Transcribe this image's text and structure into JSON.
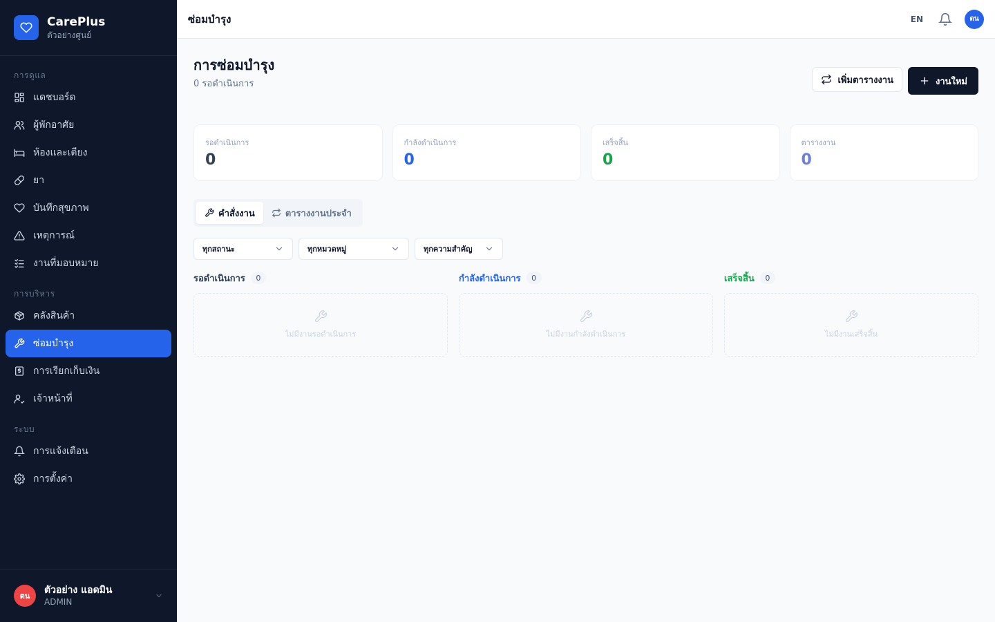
{
  "colors": {
    "sidebar_bg": "#0f172a",
    "accent": "#2563eb",
    "pending": "#334155",
    "in_progress": "#2563eb",
    "completed": "#16a34a",
    "schedules": "#6b7fd7",
    "user_avatar": "#ef4444"
  },
  "brand": {
    "name": "CarePlus",
    "subtitle": "ตัวอย่างศูนย์",
    "icon": "heart-icon"
  },
  "sidebar": {
    "sections": [
      {
        "label": "การดูแล",
        "items": [
          {
            "label": "แดชบอร์ด",
            "icon": "dashboard-icon"
          },
          {
            "label": "ผู้พักอาศัย",
            "icon": "users-icon"
          },
          {
            "label": "ห้องและเตียง",
            "icon": "bed-icon"
          },
          {
            "label": "ยา",
            "icon": "pill-icon"
          },
          {
            "label": "บันทึกสุขภาพ",
            "icon": "heart-icon"
          },
          {
            "label": "เหตุการณ์",
            "icon": "warning-icon"
          },
          {
            "label": "งานที่มอบหมาย",
            "icon": "task-list-icon"
          }
        ]
      },
      {
        "label": "การบริหาร",
        "items": [
          {
            "label": "คลังสินค้า",
            "icon": "package-icon"
          },
          {
            "label": "ซ่อมบำรุง",
            "icon": "wrench-icon",
            "active": true
          },
          {
            "label": "การเรียกเก็บเงิน",
            "icon": "receipt-icon"
          },
          {
            "label": "เจ้าหน้าที่",
            "icon": "user-check-icon"
          }
        ]
      },
      {
        "label": "ระบบ",
        "items": [
          {
            "label": "การแจ้งเตือน",
            "icon": "bell-icon"
          },
          {
            "label": "การตั้งค่า",
            "icon": "gear-icon"
          }
        ]
      }
    ]
  },
  "user": {
    "initials": "ตน",
    "name": "ตัวอย่าง แอดมิน",
    "role": "ADMIN"
  },
  "header": {
    "title": "ซ่อมบำรุง",
    "lang": "EN",
    "avatar_initials": "ตน"
  },
  "page": {
    "title": "การซ่อมบำรุง",
    "subtitle": "0 รอดำเนินการ",
    "add_schedule_label": "เพิ่มตารางงาน",
    "new_job_label": "งานใหม่"
  },
  "stats": [
    {
      "label": "รอดำเนินการ",
      "value": "0"
    },
    {
      "label": "กำลังดำเนินการ",
      "value": "0"
    },
    {
      "label": "เสร็จสิ้น",
      "value": "0"
    },
    {
      "label": "ตารางงาน",
      "value": "0"
    }
  ],
  "tabs": [
    {
      "label": "คำสั่งงาน",
      "icon": "wrench-icon",
      "active": true
    },
    {
      "label": "ตารางงานประจำ",
      "icon": "repeat-icon",
      "active": false
    }
  ],
  "filters": [
    {
      "value": "ทุกสถานะ"
    },
    {
      "value": "ทุกหมวดหมู่"
    },
    {
      "value": "ทุกความสำคัญ"
    }
  ],
  "columns": [
    {
      "title": "รอดำเนินการ",
      "count": "0",
      "empty": "ไม่มีงานรอดำเนินการ"
    },
    {
      "title": "กำลังดำเนินการ",
      "count": "0",
      "empty": "ไม่มีงานกำลังดำเนินการ"
    },
    {
      "title": "เสร็จสิ้น",
      "count": "0",
      "empty": "ไม่มีงานเสร็จสิ้น"
    }
  ]
}
